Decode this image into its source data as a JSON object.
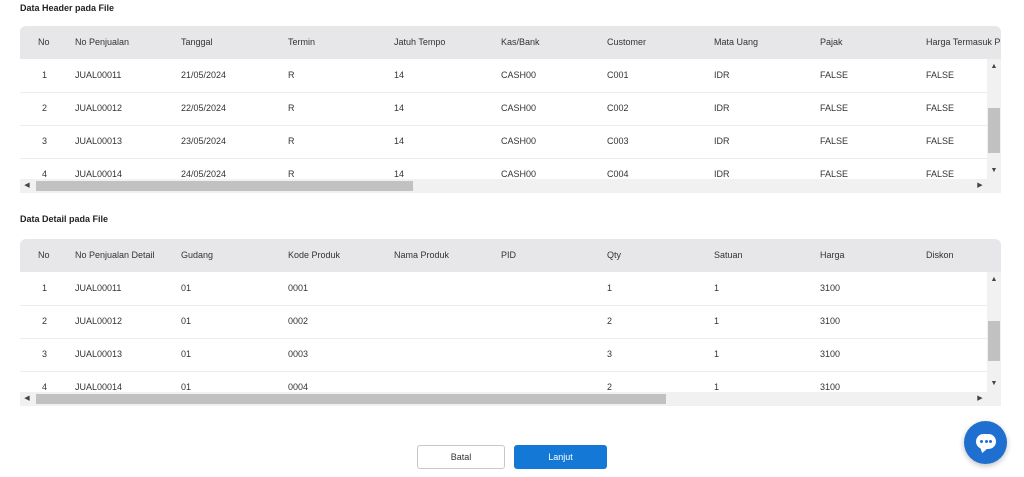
{
  "header_section": {
    "title": "Data Header pada File",
    "columns": [
      "No",
      "No Penjualan",
      "Tanggal",
      "Termin",
      "Jatuh Tempo",
      "Kas/Bank",
      "Customer",
      "Mata Uang",
      "Pajak",
      "Harga Termasuk P"
    ],
    "rows": [
      [
        "1",
        "JUAL00011",
        "21/05/2024",
        "R",
        "14",
        "CASH00",
        "C001",
        "IDR",
        "FALSE",
        "FALSE"
      ],
      [
        "2",
        "JUAL00012",
        "22/05/2024",
        "R",
        "14",
        "CASH00",
        "C002",
        "IDR",
        "FALSE",
        "FALSE"
      ],
      [
        "3",
        "JUAL00013",
        "23/05/2024",
        "R",
        "14",
        "CASH00",
        "C003",
        "IDR",
        "FALSE",
        "FALSE"
      ],
      [
        "4",
        "JUAL00014",
        "24/05/2024",
        "R",
        "14",
        "CASH00",
        "C004",
        "IDR",
        "FALSE",
        "FALSE"
      ]
    ]
  },
  "detail_section": {
    "title": "Data Detail pada File",
    "columns": [
      "No",
      "No Penjualan Detail",
      "Gudang",
      "Kode Produk",
      "Nama Produk",
      "PID",
      "Qty",
      "Satuan",
      "Harga",
      "Diskon"
    ],
    "rows": [
      [
        "1",
        "JUAL00011",
        "01",
        "0001",
        "",
        "",
        "1",
        "1",
        "3100",
        ""
      ],
      [
        "2",
        "JUAL00012",
        "01",
        "0002",
        "",
        "",
        "2",
        "1",
        "3100",
        ""
      ],
      [
        "3",
        "JUAL00013",
        "01",
        "0003",
        "",
        "",
        "3",
        "1",
        "3100",
        ""
      ],
      [
        "4",
        "JUAL00014",
        "01",
        "0004",
        "",
        "",
        "2",
        "1",
        "3100",
        ""
      ]
    ]
  },
  "buttons": {
    "cancel_label": "Batal",
    "next_label": "Lanjut"
  },
  "icons": {
    "scroll_up": "▲",
    "scroll_down": "▼",
    "scroll_left": "◀",
    "scroll_right": "▶",
    "chat": "chat-icon"
  },
  "colors": {
    "accent": "#1478d6",
    "header_bg": "#e7e7ea",
    "chat_fab": "#1f6fd0"
  }
}
